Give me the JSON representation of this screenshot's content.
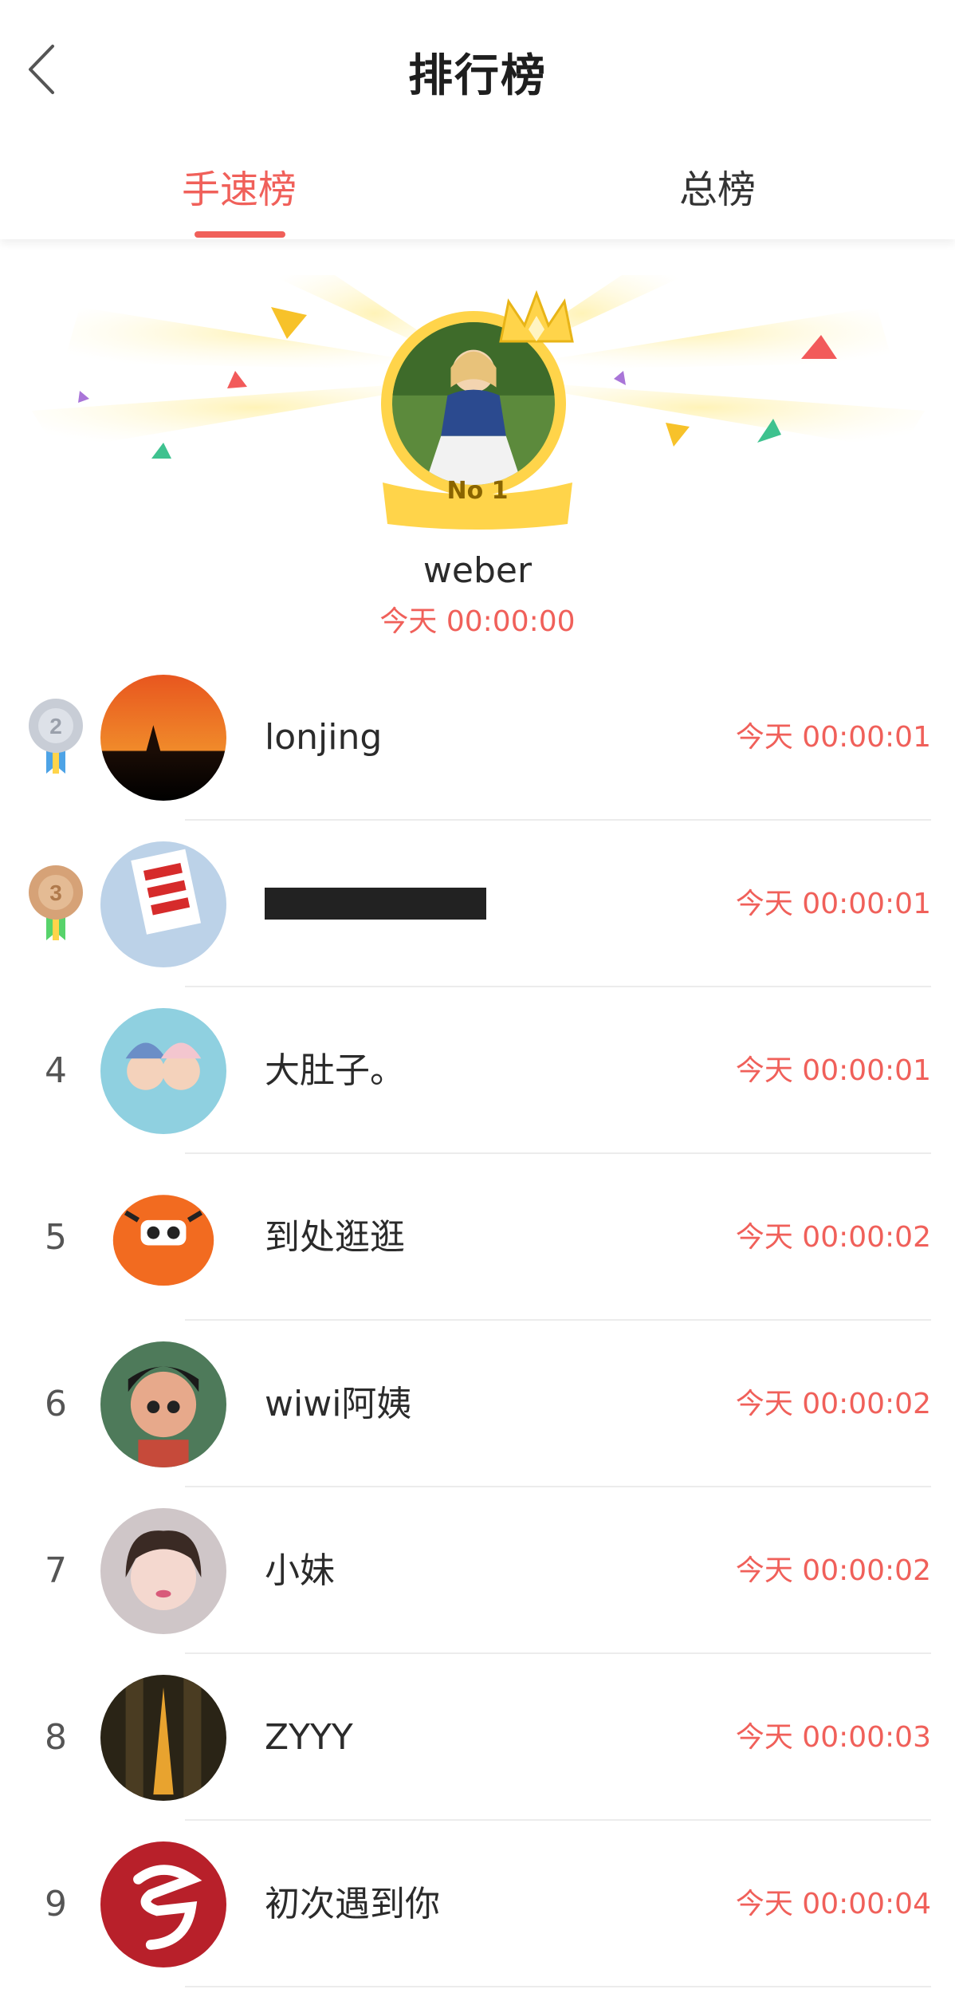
{
  "header": {
    "title": "排行榜"
  },
  "tabs": [
    {
      "label": "手速榜",
      "active": true
    },
    {
      "label": "总榜",
      "active": false
    }
  ],
  "winner": {
    "badge": "No 1",
    "name": "weber",
    "time": "今天 00:00:00"
  },
  "rankings": [
    {
      "rank": "2",
      "name": "lonjing",
      "time": "今天 00:00:01",
      "avatar": "sunset-avatar"
    },
    {
      "rank": "3",
      "name": "",
      "time": "今天 00:00:01",
      "avatar": "sign-avatar"
    },
    {
      "rank": "4",
      "name": "大肚子。",
      "time": "今天 00:00:01",
      "avatar": "babies-avatar"
    },
    {
      "rank": "5",
      "name": "到处逛逛",
      "time": "今天 00:00:02",
      "avatar": "tiger-avatar"
    },
    {
      "rank": "6",
      "name": "wiwi阿姨",
      "time": "今天 00:00:02",
      "avatar": "cartoon-avatar"
    },
    {
      "rank": "7",
      "name": "小妹",
      "time": "今天 00:00:02",
      "avatar": "portrait-avatar"
    },
    {
      "rank": "8",
      "name": "ZYYY",
      "time": "今天 00:00:03",
      "avatar": "tower-avatar"
    },
    {
      "rank": "9",
      "name": "初次遇到你",
      "time": "今天 00:00:04",
      "avatar": "logo-avatar"
    }
  ],
  "colors": {
    "accent": "#f0605a",
    "gold": "#ffd44a",
    "silver": "#c8cdd6",
    "bronze": "#d6a277"
  }
}
